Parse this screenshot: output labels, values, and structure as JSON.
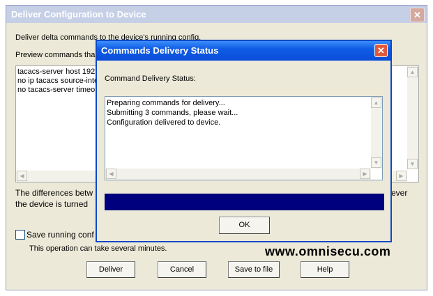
{
  "outer_window": {
    "title": "Deliver Configuration to Device",
    "close_glyph": "✕",
    "line1": "Deliver delta commands to the device's running config.",
    "line2_visible": "Preview commands tha",
    "preview_lines": [
      "tacacs-server host 192",
      "no ip tacacs source-inte",
      "no tacacs-server timeo"
    ],
    "diff_line1_left": "The differences betw",
    "diff_line1_right": "ever",
    "diff_line2_left": "the device is turned",
    "save_checkbox_label": "Save running conf",
    "note": "This operation can take several minutes.",
    "buttons": {
      "deliver": "Deliver",
      "cancel": "Cancel",
      "save_to_file": "Save to file",
      "help": "Help"
    }
  },
  "modal": {
    "title": "Commands Delivery Status",
    "close_glyph": "✕",
    "label": "Command Delivery Status:",
    "status_lines": [
      "Preparing commands for delivery...",
      "Submitting 3 commands, please wait...",
      "Configuration delivered to device."
    ],
    "progress_fraction": 1.0,
    "ok_label": "OK"
  },
  "watermark": "www.omnisecu.com",
  "colors": {
    "modal_title": "#0a4dd8",
    "progress": "#00007f",
    "dialog_bg": "#ece9d8"
  }
}
